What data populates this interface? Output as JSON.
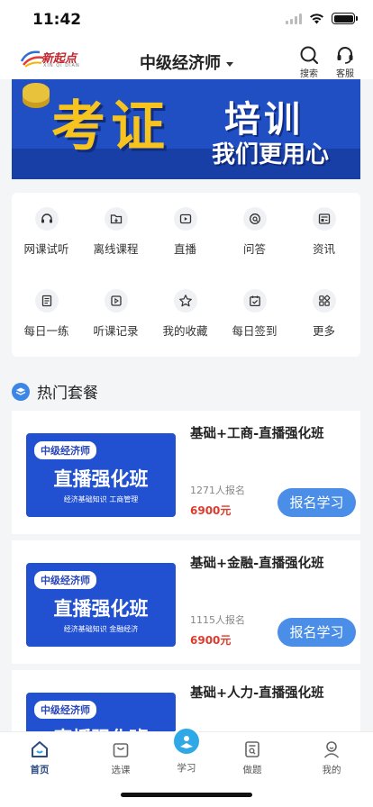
{
  "status": {
    "time": "11:42"
  },
  "header": {
    "logo_text": "新起点",
    "logo_sub": "XIN QI DIAN",
    "title": "中级经济师",
    "search_label": "搜索",
    "service_label": "客服"
  },
  "banner": {
    "big_text": "考证",
    "train_text": "培训",
    "slogan": "我们更用心"
  },
  "menu": {
    "items": [
      {
        "label": "网课试听",
        "icon": "headphones-icon"
      },
      {
        "label": "离线课程",
        "icon": "folder-download-icon"
      },
      {
        "label": "直播",
        "icon": "live-play-icon"
      },
      {
        "label": "问答",
        "icon": "qa-bubble-icon"
      },
      {
        "label": "资讯",
        "icon": "news-icon"
      },
      {
        "label": "每日一练",
        "icon": "notebook-icon"
      },
      {
        "label": "听课记录",
        "icon": "play-record-icon"
      },
      {
        "label": "我的收藏",
        "icon": "star-icon"
      },
      {
        "label": "每日签到",
        "icon": "calendar-check-icon"
      },
      {
        "label": "更多",
        "icon": "grid-more-icon"
      }
    ]
  },
  "section": {
    "title": "热门套餐"
  },
  "courses": [
    {
      "name": "基础+工商-直播强化班",
      "count": "1271人报名",
      "price": "6900元",
      "button": "报名学习",
      "tag": "中级经济师",
      "thumb_title": "直播强化班",
      "thumb_sub": "经济基础知识  工商管理"
    },
    {
      "name": "基础+金融-直播强化班",
      "count": "1115人报名",
      "price": "6900元",
      "button": "报名学习",
      "tag": "中级经济师",
      "thumb_title": "直播强化班",
      "thumb_sub": "经济基础知识  金融经济"
    },
    {
      "name": "基础+人力-直播强化班",
      "count": "",
      "price": "",
      "button": "",
      "tag": "中级经济师",
      "thumb_title": "直播强化班",
      "thumb_sub": ""
    }
  ],
  "tabbar": {
    "home": "首页",
    "courses": "选课",
    "study": "学习",
    "practice": "做题",
    "mine": "我的"
  },
  "colors": {
    "accent": "#4a8ee8",
    "price": "#e03a2a",
    "banner_bg": "#1f4fc2",
    "banner_yellow": "#f6c31f"
  }
}
